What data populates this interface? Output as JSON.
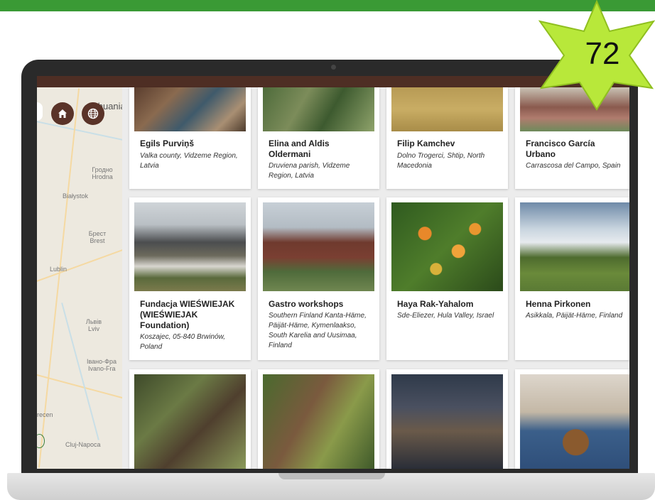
{
  "badge": {
    "number": "72"
  },
  "map": {
    "labels": [
      {
        "text": "Lithuania",
        "kind": "big"
      },
      {
        "text": "Гродно",
        "kind": "small"
      },
      {
        "text": "Hrodna",
        "kind": "small"
      },
      {
        "text": "Białystok",
        "kind": "small"
      },
      {
        "text": "Брест",
        "kind": "small"
      },
      {
        "text": "Brest",
        "kind": "small"
      },
      {
        "text": "Lublin",
        "kind": "small"
      },
      {
        "text": "Львів",
        "kind": "small"
      },
      {
        "text": "Lviv",
        "kind": "small"
      },
      {
        "text": "Івано-Фра",
        "kind": "small"
      },
      {
        "text": "Ivano-Fra",
        "kind": "small"
      },
      {
        "text": "recen",
        "kind": "small"
      },
      {
        "text": "Cluj-Napoca",
        "kind": "small"
      }
    ],
    "buttons": {
      "home_icon": "home-icon",
      "globe_icon": "globe-icon"
    }
  },
  "cards": [
    {
      "name": "Egils Purviņš",
      "location": "Valka county, Vidzeme Region, Latvia"
    },
    {
      "name": "Elina and Aldis Oldermani",
      "location": "Druviena parish, Vidzeme Region, Latvia"
    },
    {
      "name": "Filip Kamchev",
      "location": "Dolno Trogerci, Shtip, North Macedonia"
    },
    {
      "name": "Francisco García Urbano",
      "location": "Carrascosa del Campo, Spain"
    },
    {
      "name": "Fundacja WIEŚWIEJAK (WIEŚWIEJAK Foundation)",
      "location": "Koszajec, 05-840 Brwinów, Poland"
    },
    {
      "name": "Gastro workshops",
      "location": "Southern Finland Kanta-Häme, Päijät-Häme, Kymenlaakso, South Karelia and Uusimaa, Finland"
    },
    {
      "name": "Haya Rak-Yahalom",
      "location": "Sde-Eliezer, Hula Valley, Israel"
    },
    {
      "name": "Henna Pirkonen",
      "location": "Asikkala, Päijät-Häme, Finland"
    },
    {
      "name": "",
      "location": ""
    },
    {
      "name": "",
      "location": ""
    },
    {
      "name": "",
      "location": ""
    },
    {
      "name": "",
      "location": ""
    }
  ],
  "colors": {
    "top_bar": "#3a9a35",
    "header": "#4e2e24",
    "map_button": "#5a3328",
    "star": "#b8e83a"
  }
}
